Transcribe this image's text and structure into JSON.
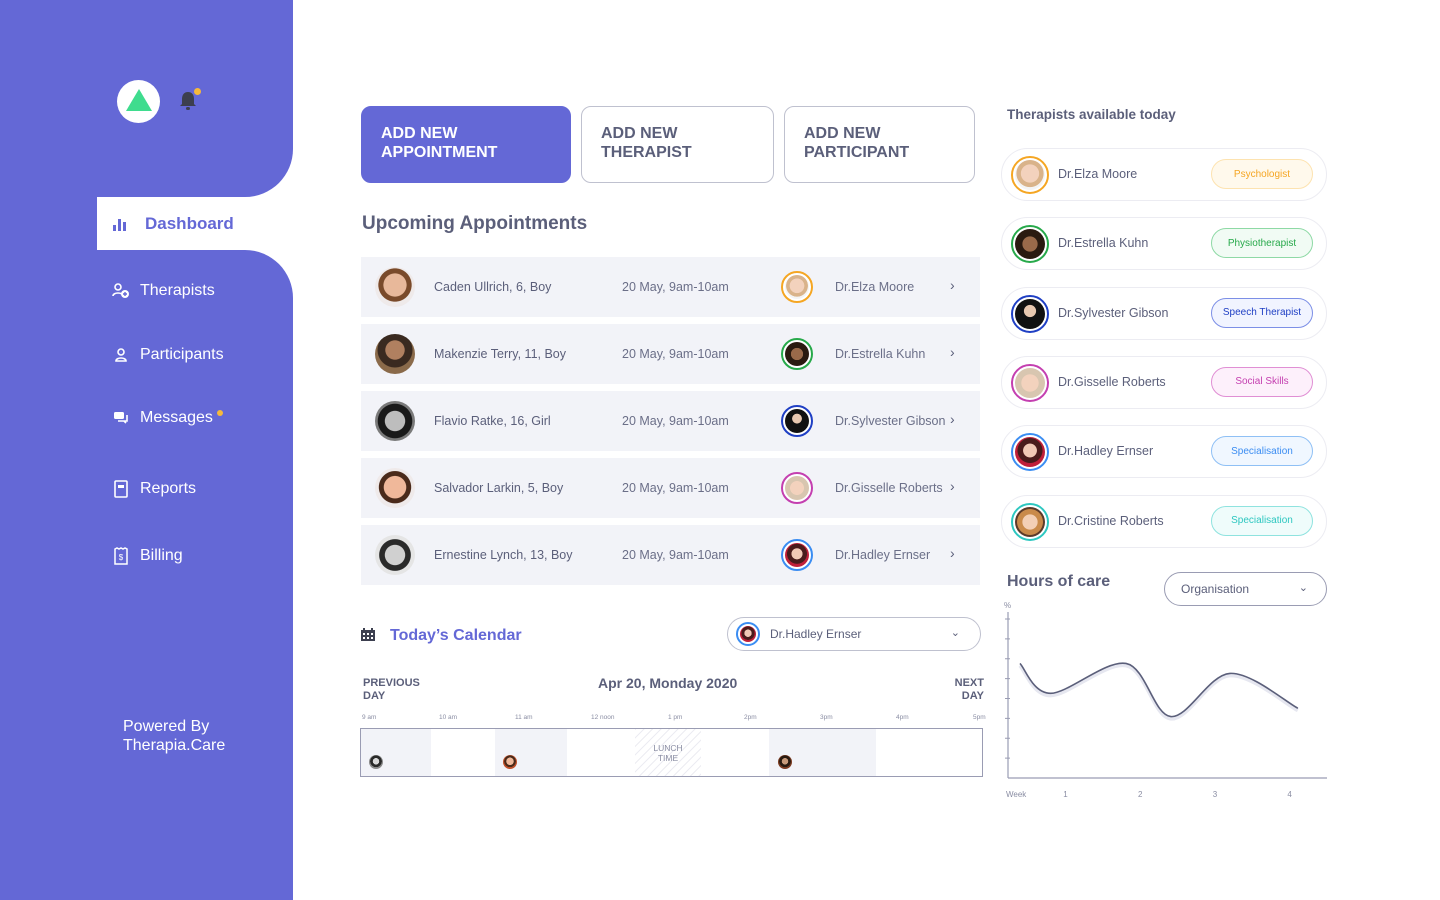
{
  "sidebar": {
    "brand_icon": "triangle-logo-icon",
    "notification_icon": "bell-icon",
    "nav": [
      {
        "label": "Dashboard",
        "icon": "bar-chart-icon",
        "active": true
      },
      {
        "label": "Therapists",
        "icon": "user-add-icon",
        "active": false
      },
      {
        "label": "Participants",
        "icon": "user-icon",
        "active": false
      },
      {
        "label": "Messages",
        "icon": "chat-icon",
        "active": false,
        "has_badge": true
      },
      {
        "label": "Reports",
        "icon": "document-icon",
        "active": false
      },
      {
        "label": "Billing",
        "icon": "receipt-icon",
        "active": false
      }
    ],
    "powered_by_line1": "Powered By",
    "powered_by_line2": "Therapia.Care"
  },
  "actions": {
    "add_appointment_l1": "ADD NEW",
    "add_appointment_l2": "APPOINTMENT",
    "add_therapist_l1": "ADD NEW",
    "add_therapist_l2": "THERAPIST",
    "add_participant_l1": "ADD NEW",
    "add_participant_l2": "PARTICIPANT"
  },
  "upcoming": {
    "title": "Upcoming Appointments",
    "rows": [
      {
        "participant": "Caden Ullrich, 6, Boy",
        "time": "20 May, 9am-10am",
        "therapist": "Dr.Elza Moore",
        "ring": "#f5a623"
      },
      {
        "participant": "Makenzie Terry, 11, Boy",
        "time": "20 May, 9am-10am",
        "therapist": "Dr.Estrella Kuhn",
        "ring": "#27a94a"
      },
      {
        "participant": "Flavio Ratke, 16, Girl",
        "time": "20 May, 9am-10am",
        "therapist": "Dr.Sylvester Gibson",
        "ring": "#1f3fc4"
      },
      {
        "participant": "Salvador Larkin, 5, Boy",
        "time": "20 May, 9am-10am",
        "therapist": "Dr.Gisselle Roberts",
        "ring": "#c43fb0"
      },
      {
        "participant": "Ernestine Lynch, 13, Boy",
        "time": "20 May, 9am-10am",
        "therapist": "Dr.Hadley Ernser",
        "ring": "#3b8df2"
      }
    ]
  },
  "calendar": {
    "title": "Today’s Calendar",
    "selected_therapist": "Dr.Hadley Ernser",
    "prev_l1": "PREVIOUS",
    "prev_l2": "DAY",
    "next_l1": "NEXT",
    "next_l2": "DAY",
    "date": "Apr 20, Monday 2020",
    "hours": [
      "9 am",
      "10 am",
      "11 am",
      "12 noon",
      "1 pm",
      "2pm",
      "3pm",
      "4pm",
      "5pm"
    ],
    "lunch_l1": "LUNCH",
    "lunch_l2": "TIME"
  },
  "available": {
    "title": "Therapists available today",
    "therapists": [
      {
        "name": "Dr.Elza Moore",
        "tag": "Psychologist",
        "color": "#f5a623",
        "tag_bg": "#fff9ec",
        "tag_border": "#fde3b0"
      },
      {
        "name": "Dr.Estrella Kuhn",
        "tag": "Physiotherapist",
        "color": "#27a94a",
        "tag_bg": "#f1fbf4",
        "tag_border": "#8ed9a5"
      },
      {
        "name": "Dr.Sylvester Gibson",
        "tag": "Speech Therapist",
        "color": "#1f3fc4",
        "tag_bg": "#f1f4ff",
        "tag_border": "#7c8fe6"
      },
      {
        "name": "Dr.Gisselle Roberts",
        "tag": "Social Skills",
        "color": "#c43fb0",
        "tag_bg": "#fdf0fb",
        "tag_border": "#e08fd4"
      },
      {
        "name": "Dr.Hadley Ernser",
        "tag": "Specialisation",
        "color": "#3b8df2",
        "tag_bg": "#f0f7ff",
        "tag_border": "#8fc0f5"
      },
      {
        "name": "Dr.Cristine Roberts",
        "tag": "Specialisation",
        "color": "#2dc7c0",
        "tag_bg": "#effcfb",
        "tag_border": "#8fe3df"
      }
    ]
  },
  "hours_of_care": {
    "title": "Hours of care",
    "filter": "Organisation"
  },
  "chart_data": {
    "type": "line",
    "title": "Hours of care",
    "ylabel": "%",
    "xlabel": "Week",
    "x_ticks": [
      "1",
      "2",
      "3",
      "4"
    ],
    "x": [
      0.39,
      0.8,
      1.81,
      2.41,
      3.2,
      4.11
    ],
    "series": [
      {
        "name": "Hours of care",
        "values": [
          69,
          51,
          69,
          37,
          63,
          42
        ]
      }
    ],
    "xlim": [
      0.23,
      4.5
    ],
    "ylim": [
      0,
      100
    ],
    "y_tick_count": 8,
    "y_tick_labels": false,
    "grid": false
  },
  "colors": {
    "brand": "#6468d6",
    "logo": "#3fdc8e",
    "badge": "#f6b93b",
    "text": "#5b5f7a",
    "row_bg": "#f2f3f8"
  }
}
